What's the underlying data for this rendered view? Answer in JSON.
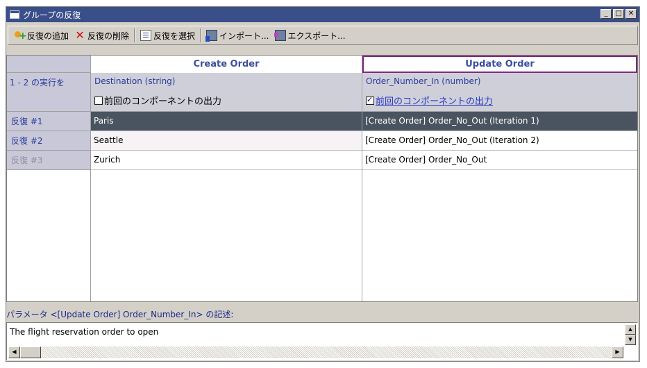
{
  "window": {
    "title": "グループの反復",
    "controls": [
      "_",
      "□",
      "✕"
    ]
  },
  "toolbar": {
    "add_label": "反復の追加",
    "delete_label": "反復の削除",
    "select_label": "反復を選択",
    "import_label": "インポート...",
    "export_label": "エクスポート..."
  },
  "grid": {
    "columns": [
      {
        "header": "Create Order",
        "param": "Destination (string)",
        "checkbox_label": "前回のコンポーネントの出力",
        "checked": false
      },
      {
        "header": "Update Order",
        "param": "Order_Number_In (number)",
        "checkbox_label": "前回のコンポーネントの出力",
        "checked": true
      }
    ],
    "run_label": "1 - 2 の実行を",
    "rows": [
      {
        "label": "反復 #1",
        "values": [
          "Paris",
          "[Create Order] Order_No_Out (Iteration 1)"
        ]
      },
      {
        "label": "反復 #2",
        "values": [
          "Seattle",
          "[Create Order] Order_No_Out (Iteration 2)"
        ]
      },
      {
        "label": "反復 #3",
        "values": [
          "Zurich",
          "[Create Order] Order_No_Out"
        ]
      }
    ]
  },
  "description": {
    "label": "パラメータ <[Update Order] Order_Number_In> の記述:",
    "text": "The flight reservation order to open"
  },
  "colors": {
    "titlebar": "#3a4f8a",
    "selected_row": "#4a5460",
    "header_text": "#3a4fa0",
    "selected_header_border": "#802880"
  }
}
